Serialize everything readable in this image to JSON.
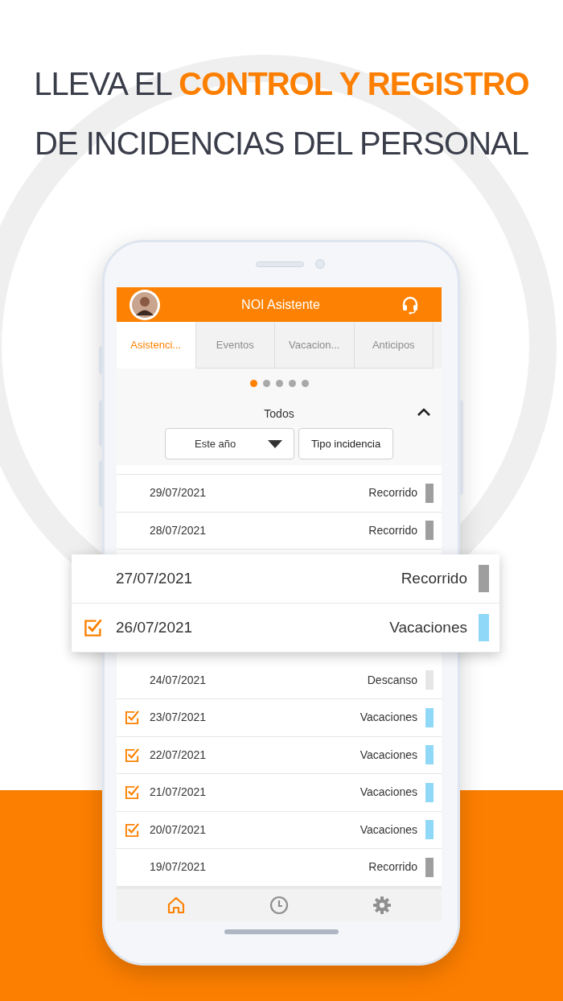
{
  "headline": {
    "line_1": "LLEVA EL **CONTROL Y REGISTRO**",
    "line_2": "DE INCIDENCIAS DEL PERSONAL"
  },
  "app_bar": {
    "title": "NOI Asistente"
  },
  "tabs": [
    {
      "label": "Asistenci...",
      "selected": true
    },
    {
      "label": "Eventos",
      "selected": false
    },
    {
      "label": "Vacacion...",
      "selected": false
    },
    {
      "label": "Anticipos",
      "selected": false
    }
  ],
  "pager_dots": [
    {
      "selected": true
    },
    {
      "selected": false
    },
    {
      "selected": false
    },
    {
      "selected": false
    },
    {
      "selected": false
    }
  ],
  "filter": {
    "label": "Todos",
    "expanded": true,
    "period": "Este año",
    "type_button": "Tipo incidencia"
  },
  "list": {
    "rows_above": [
      {
        "date": "29/07/2021",
        "status": "Recorrido",
        "checked": false,
        "color": "#9e9e9e"
      },
      {
        "date": "28/07/2021",
        "status": "Recorrido",
        "checked": false,
        "color": "#9e9e9e"
      }
    ],
    "rows_below": [
      {
        "date": "24/07/2021",
        "status": "Descanso",
        "checked": false,
        "color": "#e6e6e6"
      },
      {
        "date": "23/07/2021",
        "status": "Vacaciones",
        "checked": true,
        "color": "#90d8f8"
      },
      {
        "date": "22/07/2021",
        "status": "Vacaciones",
        "checked": true,
        "color": "#90d8f8"
      },
      {
        "date": "21/07/2021",
        "status": "Vacaciones",
        "checked": true,
        "color": "#90d8f8"
      },
      {
        "date": "20/07/2021",
        "status": "Vacaciones",
        "checked": true,
        "color": "#90d8f8"
      },
      {
        "date": "19/07/2021",
        "status": "Recorrido",
        "checked": false,
        "color": "#9e9e9e"
      }
    ]
  },
  "callout": {
    "rows": [
      {
        "date": "27/07/2021",
        "status": "Recorrido",
        "checked": false,
        "color": "#9e9e9e"
      },
      {
        "date": "26/07/2021",
        "status": "Vacaciones",
        "checked": true,
        "color": "#90d8f8"
      }
    ]
  },
  "bottom_nav": [
    {
      "kind": "home",
      "selected": true
    },
    {
      "kind": "history",
      "selected": false
    },
    {
      "kind": "settings",
      "selected": false
    }
  ]
}
